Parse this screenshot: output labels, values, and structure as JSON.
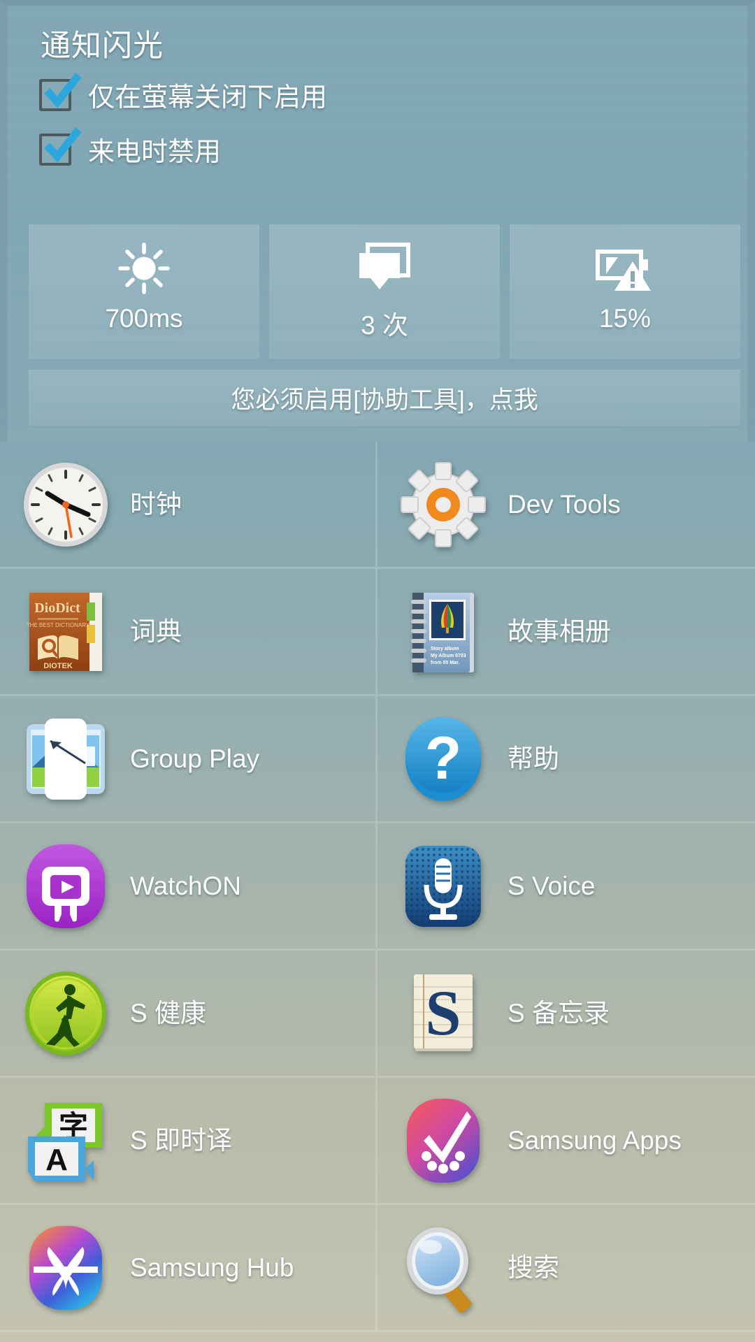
{
  "header": {
    "title": "通知闪光"
  },
  "options": [
    {
      "label": "仅在萤幕关闭下启用",
      "checked": true,
      "icon": "checkbox-checked-icon"
    },
    {
      "label": "来电时禁用",
      "checked": true,
      "icon": "checkbox-checked-icon"
    }
  ],
  "stats": [
    {
      "icon": "brightness-sun-icon",
      "value": "700ms",
      "name": "flash-duration"
    },
    {
      "icon": "notification-stack-icon",
      "value": "3 次",
      "name": "flash-count"
    },
    {
      "icon": "battery-low-warning-icon",
      "value": "15%",
      "name": "battery-threshold"
    }
  ],
  "hint": {
    "text": "您必须启用[协助工具]，点我"
  },
  "apps": [
    {
      "label": "时钟",
      "icon": "clock-icon"
    },
    {
      "label": "Dev Tools",
      "icon": "gear-icon"
    },
    {
      "label": "词典",
      "icon": "diodict-dictionary-icon"
    },
    {
      "label": "故事相册",
      "icon": "story-album-icon"
    },
    {
      "label": "Group Play",
      "icon": "group-play-icon"
    },
    {
      "label": "帮助",
      "icon": "help-question-icon"
    },
    {
      "label": "WatchON",
      "icon": "watchon-icon"
    },
    {
      "label": "S Voice",
      "icon": "microphone-icon"
    },
    {
      "label": "S 健康",
      "icon": "s-health-walker-icon"
    },
    {
      "label": "S 备忘录",
      "icon": "s-memo-icon"
    },
    {
      "label": "S 即时译",
      "icon": "s-translator-icon"
    },
    {
      "label": "Samsung Apps",
      "icon": "samsung-apps-icon"
    },
    {
      "label": "Samsung Hub",
      "icon": "samsung-hub-icon"
    },
    {
      "label": "搜索",
      "icon": "search-magnifier-icon"
    }
  ],
  "colors": {
    "accent_check": "#2ba7dd",
    "text": "#ffffff",
    "bg_top": "#7ea5b3",
    "bg_bottom": "#c4c4b1"
  }
}
